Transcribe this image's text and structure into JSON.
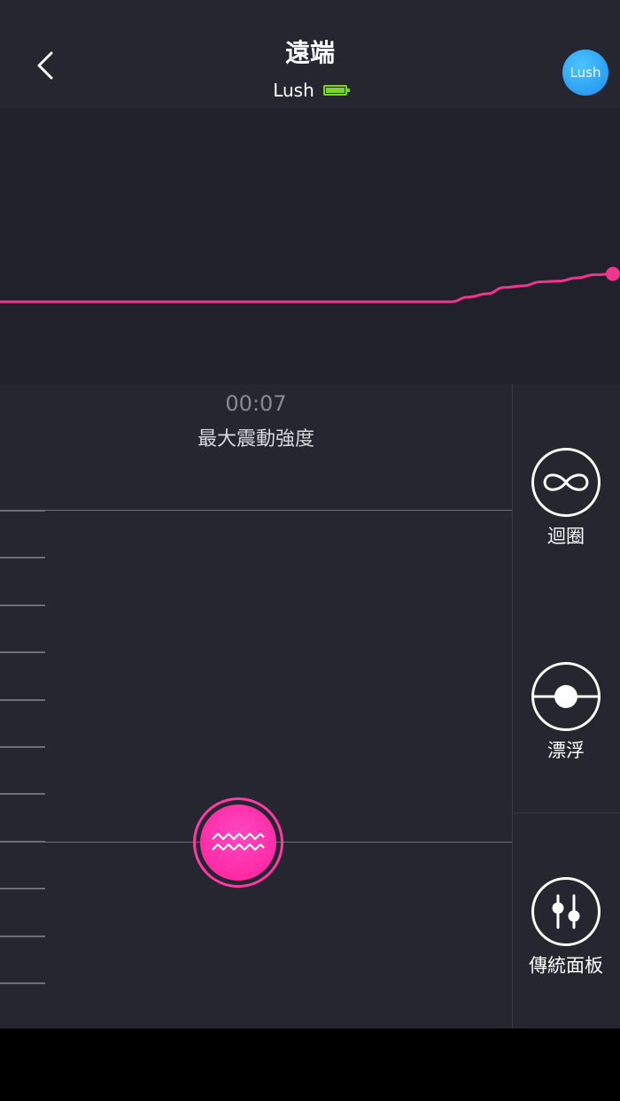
{
  "header": {
    "title": "遠端",
    "device_name": "Lush",
    "avatar_label": "Lush",
    "battery_color": "#7bd624"
  },
  "graph": {
    "line_color": "#f0348f",
    "levels": [
      0,
      0,
      0,
      0,
      0,
      0,
      0,
      0,
      0,
      0,
      0,
      0,
      0,
      0,
      0,
      0,
      0,
      0,
      0,
      0,
      0,
      0,
      0,
      0,
      0,
      0,
      0.06,
      0.1,
      0.18,
      0.2,
      0.25,
      0.26,
      0.3,
      0.34,
      0.35
    ]
  },
  "control": {
    "timer": "00:07",
    "mode_label": "最大震動強度",
    "knob_color": "#ff2fae"
  },
  "sidebar": {
    "loop_label": "迴圈",
    "float_label": "漂浮",
    "classic_label": "傳統面板"
  },
  "colors": {
    "accent": "#ff2fae",
    "background": "#25262f",
    "graph_background": "#20212a"
  }
}
